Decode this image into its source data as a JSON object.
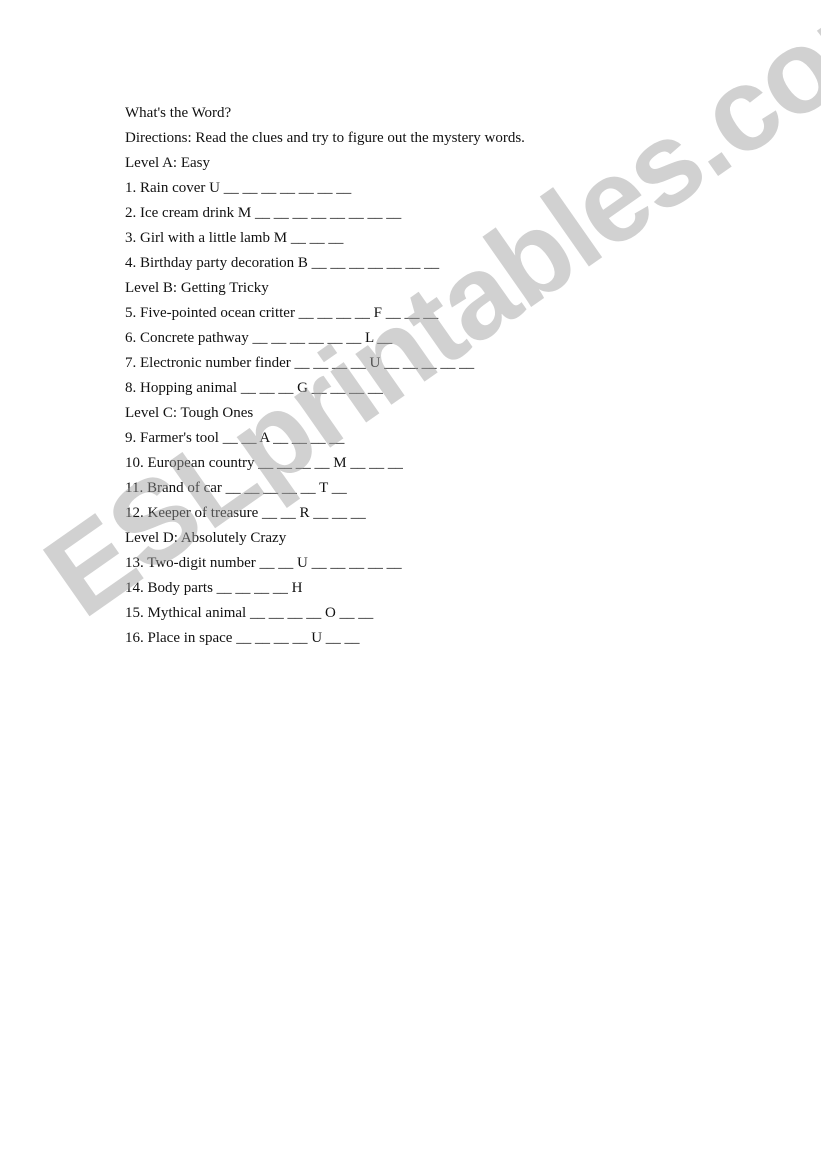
{
  "title": "What's the Word?",
  "directions": "Directions: Read the clues and try to figure out the mystery words.",
  "levels": [
    {
      "heading": "Level A: Easy",
      "clues": [
        {
          "text": "1. Rain cover U __ __ __ __ __ __ __"
        },
        {
          "text": "2. Ice cream drink M __ __ __ __ __ __ __ __"
        },
        {
          "text": "3. Girl with a little lamb M __ __ __"
        },
        {
          "text": "4. Birthday party decoration B __ __ __ __ __ __ __"
        }
      ]
    },
    {
      "heading": "Level B: Getting Tricky",
      "clues": [
        {
          "text": "5. Five-pointed ocean critter __ __ __ __ F __ __ __"
        },
        {
          "text": "6. Concrete pathway __ __ __ __ __ __ L __"
        },
        {
          "text": "7. Electronic number finder __ __ __ __ U __ __ __ __ __"
        },
        {
          "text": "8. Hopping animal __ __ __ G __ __ __ __"
        }
      ]
    },
    {
      "heading": "Level C: Tough Ones",
      "clues": [
        {
          "text": "9. Farmer's tool __ __ A __ __ __ __"
        },
        {
          "text": "10. European country __ __ __ __ M __ __ __"
        },
        {
          "text": "11. Brand of car __ __ __ __ __ T __"
        },
        {
          "text": "12. Keeper of treasure __ __ R __ __ __"
        }
      ]
    },
    {
      "heading": "Level D: Absolutely Crazy",
      "clues": [
        {
          "text": "13. Two-digit number __ __ U __ __ __ __ __"
        },
        {
          "text": "14. Body parts __ __ __ __ H"
        },
        {
          "text": "15. Mythical animal __ __ __ __ O __ __"
        },
        {
          "text": "16. Place in space __ __ __ __ U __ __"
        }
      ]
    }
  ],
  "watermark": "ESLprintables.com"
}
